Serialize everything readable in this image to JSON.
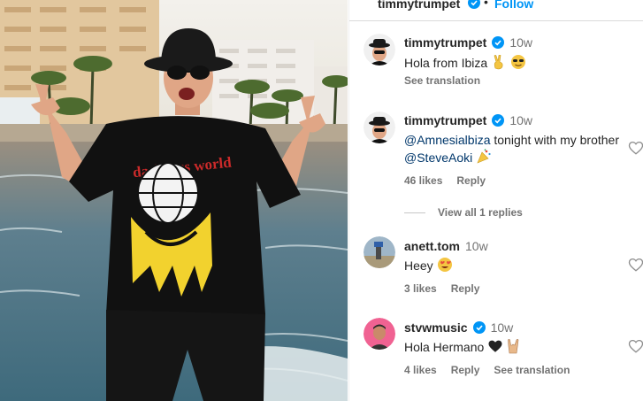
{
  "header": {
    "username": "timmytrumpet",
    "separator": "•",
    "follow_label": "Follow"
  },
  "comments": [
    {
      "username": "timmytrumpet",
      "verified": true,
      "time": "10w",
      "text": "Hola from Ibiza",
      "emojis": [
        "victory-hand-emoji",
        "sunglasses-face-emoji"
      ],
      "actions": [
        "See translation"
      ]
    },
    {
      "username": "timmytrumpet",
      "verified": true,
      "time": "10w",
      "mention1": "@Amnesialbiza",
      "text_middle": " tonight with my brother ",
      "mention2": "@SteveAoki",
      "emojis": [
        "party-popper-emoji"
      ],
      "likes": "46 likes",
      "reply_label": "Reply",
      "view_replies": "View all 1 replies"
    },
    {
      "username": "anett.tom",
      "verified": false,
      "time": "10w",
      "text": "Heey",
      "emojis": [
        "heart-eyes-emoji"
      ],
      "likes": "3 likes",
      "reply_label": "Reply"
    },
    {
      "username": "stvwmusic",
      "verified": true,
      "time": "10w",
      "text": "Hola Hermano",
      "emojis": [
        "black-heart-emoji",
        "sign-of-horns-emoji"
      ],
      "likes": "4 likes",
      "reply_label": "Reply",
      "translation_label": "See translation"
    }
  ],
  "colors": {
    "verified_blue": "#0095f6",
    "link_blue": "#00376b",
    "muted_gray": "#737373",
    "shirt_black": "#111111",
    "smiley_yellow": "#f2d22e"
  }
}
